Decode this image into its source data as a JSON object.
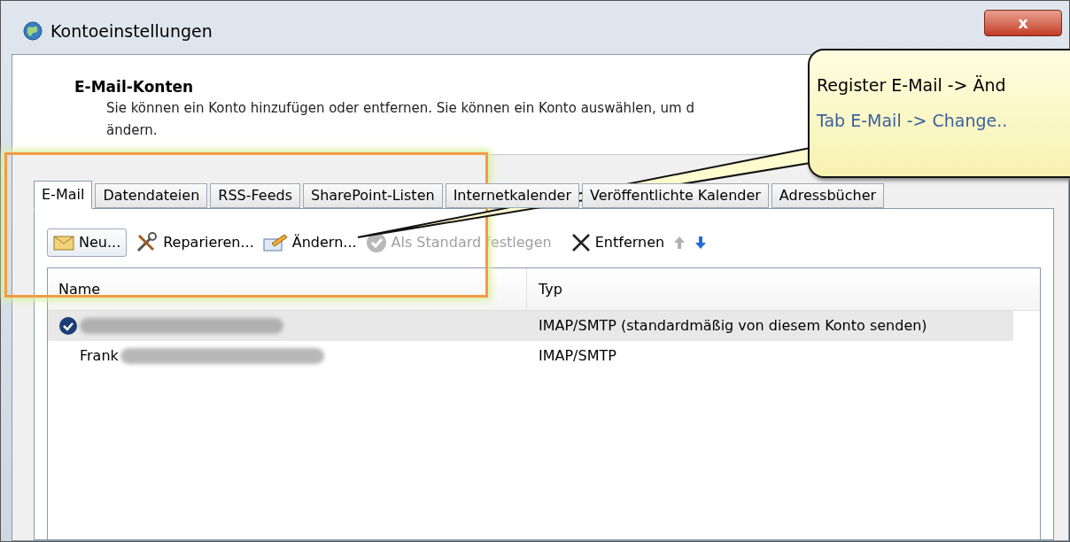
{
  "window": {
    "title": "Kontoeinstellungen",
    "close": "x"
  },
  "header": {
    "title": "E-Mail-Konten",
    "description": "Sie können ein Konto hinzufügen oder entfernen. Sie können ein Konto auswählen, um d",
    "description_2": "ändern."
  },
  "tabs": [
    {
      "label": "E-Mail",
      "selected": true
    },
    {
      "label": "Datendateien",
      "selected": false
    },
    {
      "label": "RSS-Feeds",
      "selected": false
    },
    {
      "label": "SharePoint-Listen",
      "selected": false
    },
    {
      "label": "Internetkalender",
      "selected": false
    },
    {
      "label": "Veröffentlichte Kalender",
      "selected": false
    },
    {
      "label": "Adressbücher",
      "selected": false
    }
  ],
  "toolbar": [
    {
      "kind": "new",
      "label": "Neu...",
      "disabled": false
    },
    {
      "kind": "repair",
      "label": "Reparieren...",
      "disabled": false
    },
    {
      "kind": "change",
      "label": "Ändern...",
      "disabled": false
    },
    {
      "kind": "default",
      "label": "Als Standard festlegen",
      "disabled": true
    },
    {
      "kind": "remove",
      "label": "Entfernen",
      "disabled": false
    },
    {
      "kind": "up",
      "disabled": true
    },
    {
      "kind": "down",
      "disabled": false
    }
  ],
  "table": {
    "columns": [
      "Name",
      "Typ"
    ],
    "rows": [
      {
        "name": "",
        "type": "IMAP/SMTP (standardmäßig von diesem Konto senden)",
        "default": true,
        "selected": true
      },
      {
        "name": "Frank",
        "type": "IMAP/SMTP",
        "default": false,
        "selected": false
      }
    ]
  },
  "callout": {
    "lines": [
      "Register E-Mail -> Änd",
      "Tab E-Mail -> Change.."
    ]
  }
}
